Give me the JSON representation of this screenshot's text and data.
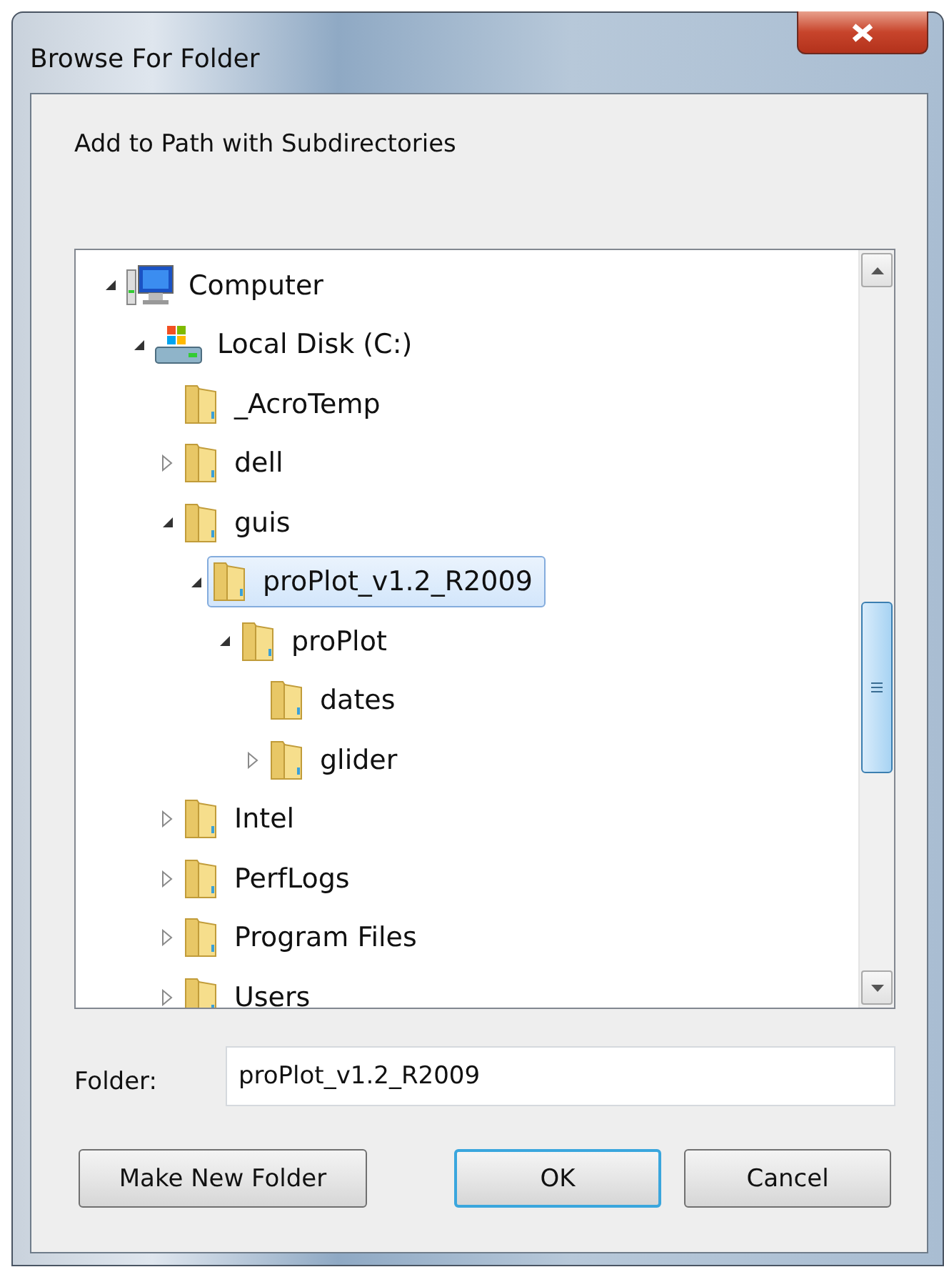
{
  "window": {
    "title": "Browse For Folder"
  },
  "description": "Add to Path with Subdirectories",
  "tree": [
    {
      "label": "Computer",
      "kind": "computer",
      "expandable": true,
      "expanded": true,
      "selected": false,
      "children": [
        {
          "label": "Local Disk (C:)",
          "kind": "drive",
          "expandable": true,
          "expanded": true,
          "selected": false,
          "children": [
            {
              "label": "_AcroTemp",
              "kind": "folder",
              "expandable": false,
              "selected": false
            },
            {
              "label": "dell",
              "kind": "folder",
              "expandable": true,
              "expanded": false,
              "selected": false
            },
            {
              "label": "guis",
              "kind": "folder",
              "expandable": true,
              "expanded": true,
              "selected": false,
              "children": [
                {
                  "label": "proPlot_v1.2_R2009",
                  "kind": "folder",
                  "expandable": true,
                  "expanded": true,
                  "selected": true,
                  "children": [
                    {
                      "label": "proPlot",
                      "kind": "folder",
                      "expandable": true,
                      "expanded": true,
                      "selected": false,
                      "children": [
                        {
                          "label": "dates",
                          "kind": "folder",
                          "expandable": false,
                          "selected": false
                        },
                        {
                          "label": "glider",
                          "kind": "folder",
                          "expandable": true,
                          "expanded": false,
                          "selected": false
                        }
                      ]
                    }
                  ]
                }
              ]
            },
            {
              "label": "Intel",
              "kind": "folder",
              "expandable": true,
              "expanded": false,
              "selected": false
            },
            {
              "label": "PerfLogs",
              "kind": "folder",
              "expandable": true,
              "expanded": false,
              "selected": false
            },
            {
              "label": "Program Files",
              "kind": "folder",
              "expandable": true,
              "expanded": false,
              "selected": false
            },
            {
              "label": "Users",
              "kind": "folder",
              "expandable": true,
              "expanded": false,
              "selected": false
            }
          ]
        }
      ]
    }
  ],
  "folder_field": {
    "label": "Folder:",
    "value": "proPlot_v1.2_R2009"
  },
  "buttons": [
    {
      "label": "Make New Folder",
      "default": false
    },
    {
      "label": "OK",
      "default": true
    },
    {
      "label": "Cancel",
      "default": false
    }
  ]
}
